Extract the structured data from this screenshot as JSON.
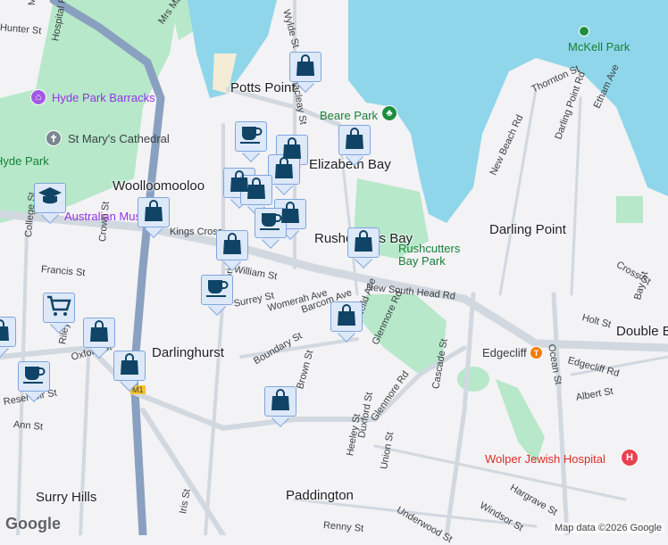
{
  "places": {
    "potts_point": "Potts Point",
    "elizabeth_bay": "Elizabeth Bay",
    "woolloomooloo": "Woolloomooloo",
    "rushcutters_bay": "Rushcutters Bay",
    "darling_point": "Darling Point",
    "darlinghurst": "Darlinghurst",
    "surry_hills": "Surry Hills",
    "paddington": "Paddington",
    "double_bay": "Double Bay",
    "kings_cross": "Kings Cross"
  },
  "pois": {
    "hyde_park_barracks": "Hyde Park Barracks",
    "st_marys": "St Mary's Cathedral",
    "hyde_park": "Hyde Park",
    "australian_museum": "Australian Museum",
    "beare_park": "Beare Park",
    "mckell_park": "McKell Park",
    "rushcutters_bay_park": "Rushcutters Bay Park",
    "edgecliff": "Edgecliff",
    "wolper": "Wolper Jewish Hospital"
  },
  "streets": [
    "Macquarie St",
    "Hospital Rd",
    "Mrs Macquaries Rd",
    "Wylde St",
    "Macleay St",
    "Thornton St",
    "Etham Ave",
    "Darling Point Rd",
    "New Beach Rd",
    "College St",
    "Francis St",
    "Crown St",
    "William St",
    "Victoria St",
    "Surrey St",
    "Womerah Ave",
    "Barcom Ave",
    "Neild Ave",
    "New South Head Rd",
    "Boundary St",
    "Riley St",
    "Oxford St",
    "Reservoir St",
    "Ann St",
    "Brown St",
    "Glenmore Rd",
    "Glenmore Rd",
    "Cascade St",
    "Heeley St",
    "Duxford St",
    "Union St",
    "Iris St",
    "Ocean St",
    "Edgecliff Rd",
    "Albert St",
    "Holt St",
    "Cross St",
    "Bay St",
    "Hargrave St",
    "Windsor St",
    "Underwood St",
    "Renny St",
    "Hunter St",
    "M1"
  ],
  "markers": [
    {
      "icon": "shopping-bag-icon"
    },
    {
      "icon": "shopping-bag-icon"
    },
    {
      "icon": "shopping-bag-icon"
    },
    {
      "icon": "shopping-bag-icon"
    },
    {
      "icon": "shopping-bag-icon"
    },
    {
      "icon": "shopping-bag-icon"
    },
    {
      "icon": "shopping-bag-icon"
    },
    {
      "icon": "shopping-bag-icon"
    },
    {
      "icon": "shopping-bag-icon"
    },
    {
      "icon": "shopping-bag-icon"
    },
    {
      "icon": "shopping-bag-icon"
    },
    {
      "icon": "shopping-bag-icon"
    },
    {
      "icon": "shopping-bag-icon"
    },
    {
      "icon": "shopping-bag-icon"
    },
    {
      "icon": "shopping-bag-icon"
    },
    {
      "icon": "coffee-cup-icon"
    },
    {
      "icon": "coffee-cup-icon"
    },
    {
      "icon": "coffee-cup-icon"
    },
    {
      "icon": "coffee-cup-icon"
    },
    {
      "icon": "shopping-cart-icon"
    },
    {
      "icon": "graduation-cap-icon"
    }
  ],
  "attribution": "Map data ©2026 Google",
  "logo": "Google",
  "colors": {
    "water": "#8fd6ea",
    "park": "#b6e8c9",
    "road": "#d2d8e0",
    "marker_fill": "#dde8f8",
    "marker_icon": "#0f4466"
  }
}
